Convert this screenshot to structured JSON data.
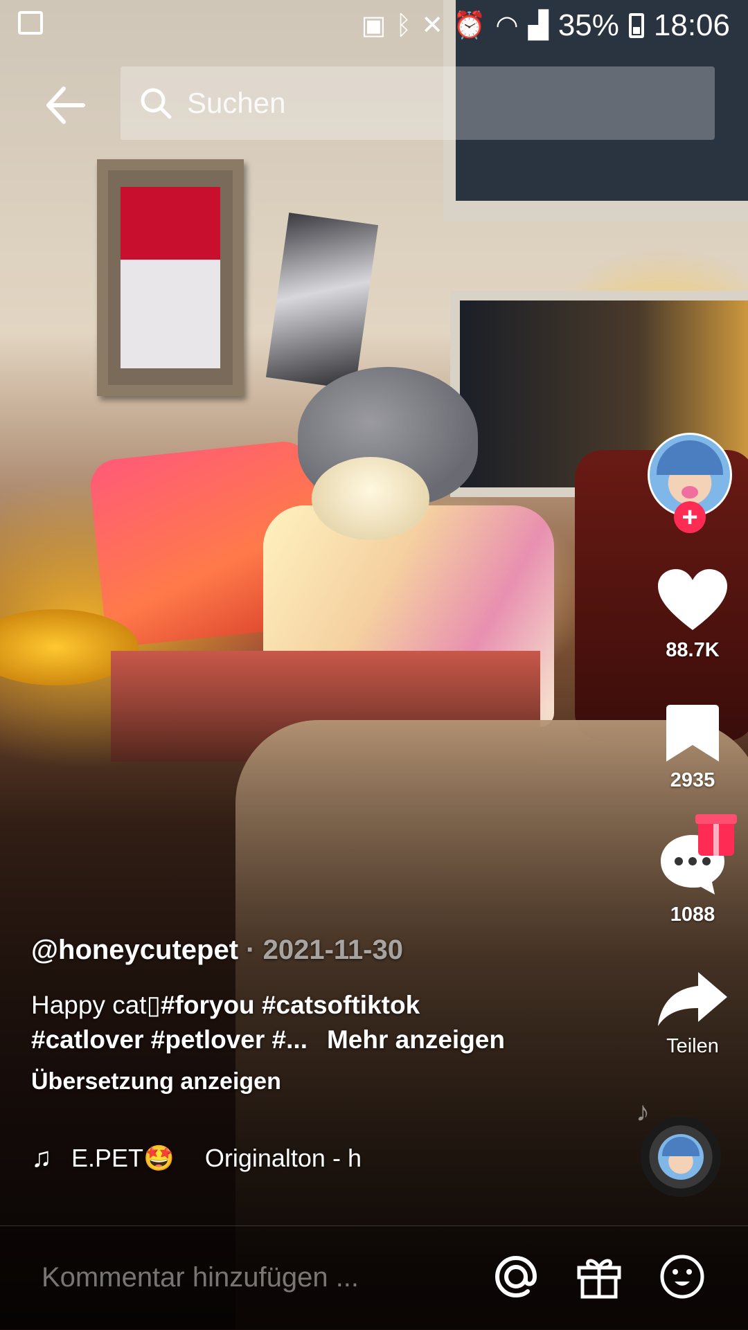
{
  "status_bar": {
    "battery": "35%",
    "time": "18:06"
  },
  "search": {
    "placeholder": "Suchen"
  },
  "actions": {
    "likes": "88.7K",
    "saves": "2935",
    "comments": "1088",
    "share_label": "Teilen"
  },
  "post": {
    "author": "@honeycutepet",
    "separator": " · ",
    "date": "2021-11-30",
    "description_line1_text": "Happy cat",
    "description_line1_tags": "#foryou #catsoftiktok",
    "description_line2_tags": "#catlover #petlover #...",
    "more_label": "Mehr anzeigen",
    "translate_label": "Übersetzung anzeigen"
  },
  "sound": {
    "creator_fragment": "E.PET🤩",
    "title": "Originalton - h"
  },
  "comment_bar": {
    "placeholder": "Kommentar hinzufügen ..."
  },
  "colors": {
    "accent": "#fe2c55"
  }
}
